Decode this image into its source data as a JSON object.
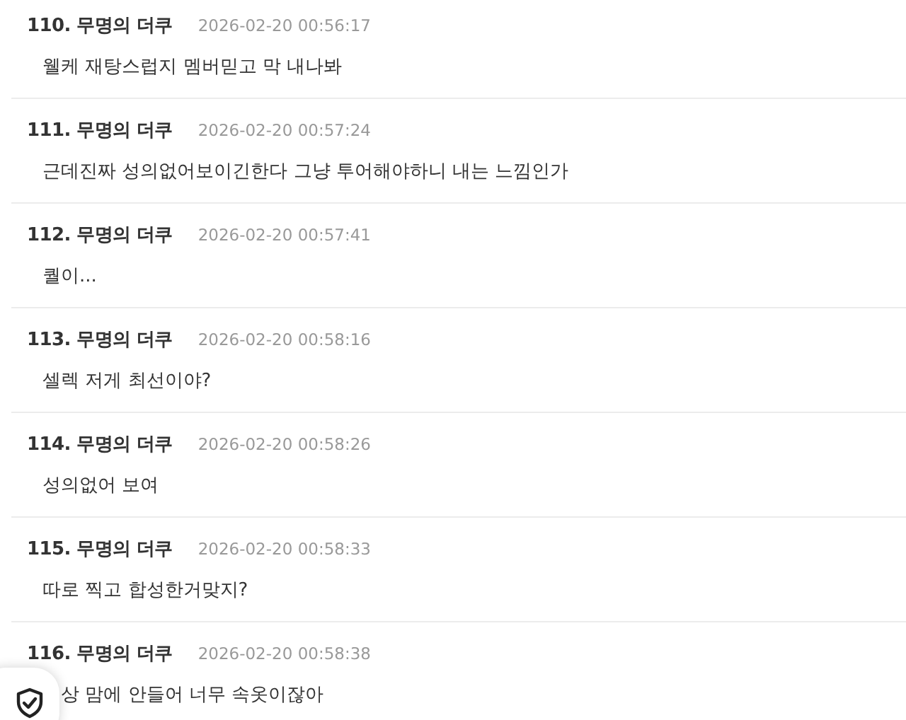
{
  "comments": [
    {
      "number": "110.",
      "author": "무명의 더쿠",
      "time": "2026-02-20 00:56:17",
      "text": "웰케 재탕스럽지 멤버믿고 막 내나봐"
    },
    {
      "number": "111.",
      "author": "무명의 더쿠",
      "time": "2026-02-20 00:57:24",
      "text": "근데진짜 성의없어보이긴한다 그냥 투어해야하니 내는 느낌인가"
    },
    {
      "number": "112.",
      "author": "무명의 더쿠",
      "time": "2026-02-20 00:57:41",
      "text": "퀄이..."
    },
    {
      "number": "113.",
      "author": "무명의 더쿠",
      "time": "2026-02-20 00:58:16",
      "text": "셀렉 저게 최선이야?"
    },
    {
      "number": "114.",
      "author": "무명의 더쿠",
      "time": "2026-02-20 00:58:26",
      "text": "성의없어 보여"
    },
    {
      "number": "115.",
      "author": "무명의 더쿠",
      "time": "2026-02-20 00:58:33",
      "text": "따로 찍고 합성한거맞지?"
    },
    {
      "number": "116.",
      "author": "무명의 더쿠",
      "time": "2026-02-20 00:58:38",
      "text": "상 맘에 안들어 너무 속옷이잖아"
    }
  ]
}
